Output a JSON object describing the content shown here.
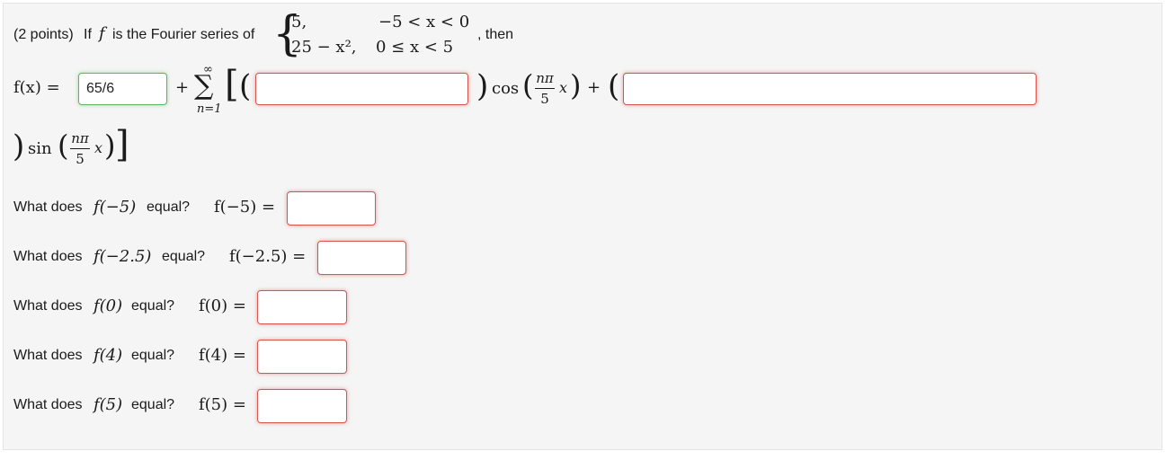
{
  "problem": {
    "points_label": "(2 points)",
    "if_word": "If",
    "f_symbol": "f",
    "is_text": "is the Fourier series of",
    "then_text": ", then"
  },
  "piecewise": {
    "row1_value": "5,",
    "row1_condition": "−5 < x < 0",
    "row2_value": "25 − x², ",
    "row2_condition": "0 ≤ x < 5"
  },
  "series": {
    "lhs": "f(x) =",
    "a0_value": "65/6",
    "plus": "+",
    "sum_sym": "∑",
    "sum_upper": "∞",
    "sum_lower": "n=1",
    "open_bracket": "[",
    "open_paren_a": "(",
    "close_paren_a": ")",
    "cos_label": "cos",
    "frac_num": "nπ",
    "frac_den": "5",
    "x_var": "x",
    "plus2": "+",
    "open_paren_b": "(",
    "close_paren_b": ")",
    "sin_label": "sin",
    "close_bracket": "]",
    "an_value": "",
    "bn_value": ""
  },
  "questions": [
    {
      "prompt_a": "What does",
      "fx": "f(−5)",
      "prompt_b": "equal?",
      "lhs": "f(−5) =",
      "value": ""
    },
    {
      "prompt_a": "What does",
      "fx": "f(−2.5)",
      "prompt_b": "equal?",
      "lhs": "f(−2.5) =",
      "value": ""
    },
    {
      "prompt_a": "What does",
      "fx": "f(0)",
      "prompt_b": "equal?",
      "lhs": "f(0) =",
      "value": ""
    },
    {
      "prompt_a": "What does",
      "fx": "f(4)",
      "prompt_b": "equal?",
      "lhs": "f(4) =",
      "value": ""
    },
    {
      "prompt_a": "What does",
      "fx": "f(5)",
      "prompt_b": "equal?",
      "lhs": "f(5) =",
      "value": ""
    }
  ],
  "colors": {
    "correct": "#5cb85c",
    "incorrect": "#d9534f"
  }
}
